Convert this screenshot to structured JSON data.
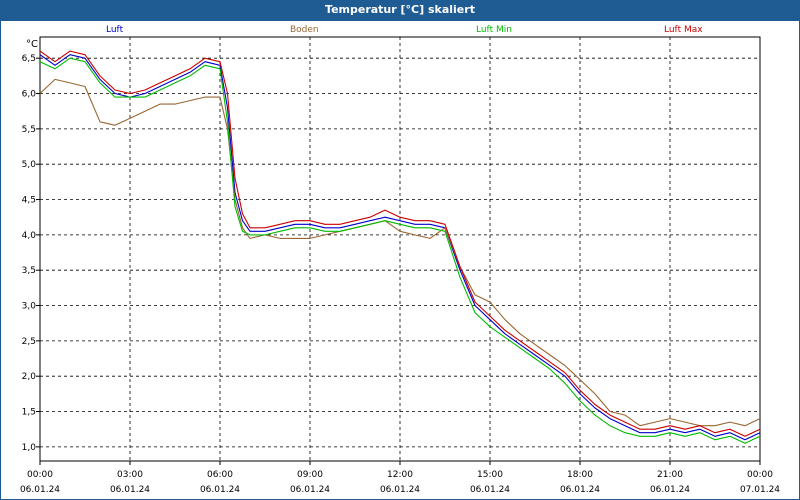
{
  "window": {
    "title": "Temperatur [°C] skaliert"
  },
  "chart_data": {
    "type": "line",
    "title": "Temperatur [°C] skaliert",
    "ylabel": "°C",
    "ylim": [
      0.8,
      6.8
    ],
    "xlim_hours": [
      0,
      24
    ],
    "grid": true,
    "legend_placement": "top",
    "y_ticks": [
      "1,0",
      "1,5",
      "2,0",
      "2,5",
      "3,0",
      "3,5",
      "4,0",
      "4,5",
      "5,0",
      "5,5",
      "6,0",
      "6,5"
    ],
    "x_ticks": [
      {
        "time": "00:00",
        "date": "06.01.24"
      },
      {
        "time": "03:00",
        "date": "06.01.24"
      },
      {
        "time": "06:00",
        "date": "06.01.24"
      },
      {
        "time": "09:00",
        "date": "06.01.24"
      },
      {
        "time": "12:00",
        "date": "06.01.24"
      },
      {
        "time": "15:00",
        "date": "06.01.24"
      },
      {
        "time": "18:00",
        "date": "06.01.24"
      },
      {
        "time": "21:00",
        "date": "06.01.24"
      },
      {
        "time": "00:00",
        "date": "07.01.24"
      }
    ],
    "x_hours": [
      0,
      0.5,
      1,
      1.5,
      2,
      2.5,
      3,
      3.5,
      4,
      4.5,
      5,
      5.5,
      6,
      6.25,
      6.5,
      6.75,
      7,
      7.5,
      8,
      8.5,
      9,
      9.5,
      10,
      10.5,
      11,
      11.5,
      12,
      12.5,
      13,
      13.5,
      14,
      14.5,
      15,
      15.5,
      16,
      16.5,
      17,
      17.5,
      18,
      18.5,
      19,
      19.5,
      20,
      20.5,
      21,
      21.5,
      22,
      22.5,
      23,
      23.5,
      24
    ],
    "series": [
      {
        "name": "Luft",
        "color": "#0000cc",
        "values": [
          6.55,
          6.4,
          6.55,
          6.5,
          6.2,
          6.0,
          5.95,
          6.0,
          6.1,
          6.2,
          6.3,
          6.45,
          6.4,
          5.8,
          4.6,
          4.2,
          4.05,
          4.05,
          4.1,
          4.15,
          4.15,
          4.1,
          4.1,
          4.15,
          4.2,
          4.25,
          4.2,
          4.15,
          4.15,
          4.1,
          3.5,
          3.0,
          2.8,
          2.6,
          2.45,
          2.3,
          2.15,
          2.0,
          1.75,
          1.55,
          1.4,
          1.3,
          1.2,
          1.2,
          1.25,
          1.2,
          1.25,
          1.15,
          1.2,
          1.1,
          1.2
        ]
      },
      {
        "name": "Boden",
        "color": "#996633",
        "values": [
          6.0,
          6.2,
          6.15,
          6.1,
          5.6,
          5.55,
          5.65,
          5.75,
          5.85,
          5.85,
          5.9,
          5.95,
          5.95,
          5.5,
          4.5,
          4.1,
          3.95,
          4.0,
          3.95,
          3.95,
          3.95,
          4.0,
          4.05,
          4.1,
          4.15,
          4.2,
          4.05,
          4.0,
          3.95,
          4.1,
          3.55,
          3.15,
          3.05,
          2.8,
          2.6,
          2.45,
          2.3,
          2.15,
          1.95,
          1.75,
          1.5,
          1.45,
          1.3,
          1.35,
          1.4,
          1.35,
          1.3,
          1.3,
          1.35,
          1.3,
          1.4
        ]
      },
      {
        "name": "Luft Min",
        "color": "#00bb00",
        "values": [
          6.45,
          6.35,
          6.5,
          6.45,
          6.15,
          5.95,
          5.95,
          5.95,
          6.05,
          6.15,
          6.25,
          6.4,
          6.35,
          5.6,
          4.4,
          4.05,
          4.0,
          4.0,
          4.05,
          4.1,
          4.1,
          4.05,
          4.05,
          4.1,
          4.15,
          4.2,
          4.15,
          4.1,
          4.1,
          4.05,
          3.4,
          2.9,
          2.7,
          2.55,
          2.4,
          2.25,
          2.1,
          1.9,
          1.65,
          1.45,
          1.3,
          1.2,
          1.15,
          1.15,
          1.2,
          1.15,
          1.2,
          1.1,
          1.15,
          1.05,
          1.15
        ]
      },
      {
        "name": "Luft Max",
        "color": "#cc0000",
        "values": [
          6.6,
          6.45,
          6.6,
          6.55,
          6.25,
          6.05,
          6.0,
          6.05,
          6.15,
          6.25,
          6.35,
          6.5,
          6.45,
          6.0,
          4.8,
          4.3,
          4.1,
          4.1,
          4.15,
          4.2,
          4.2,
          4.15,
          4.15,
          4.2,
          4.25,
          4.35,
          4.25,
          4.2,
          4.2,
          4.15,
          3.55,
          3.05,
          2.85,
          2.65,
          2.5,
          2.35,
          2.2,
          2.05,
          1.8,
          1.6,
          1.45,
          1.35,
          1.25,
          1.25,
          1.3,
          1.25,
          1.3,
          1.2,
          1.25,
          1.15,
          1.25
        ]
      }
    ]
  }
}
